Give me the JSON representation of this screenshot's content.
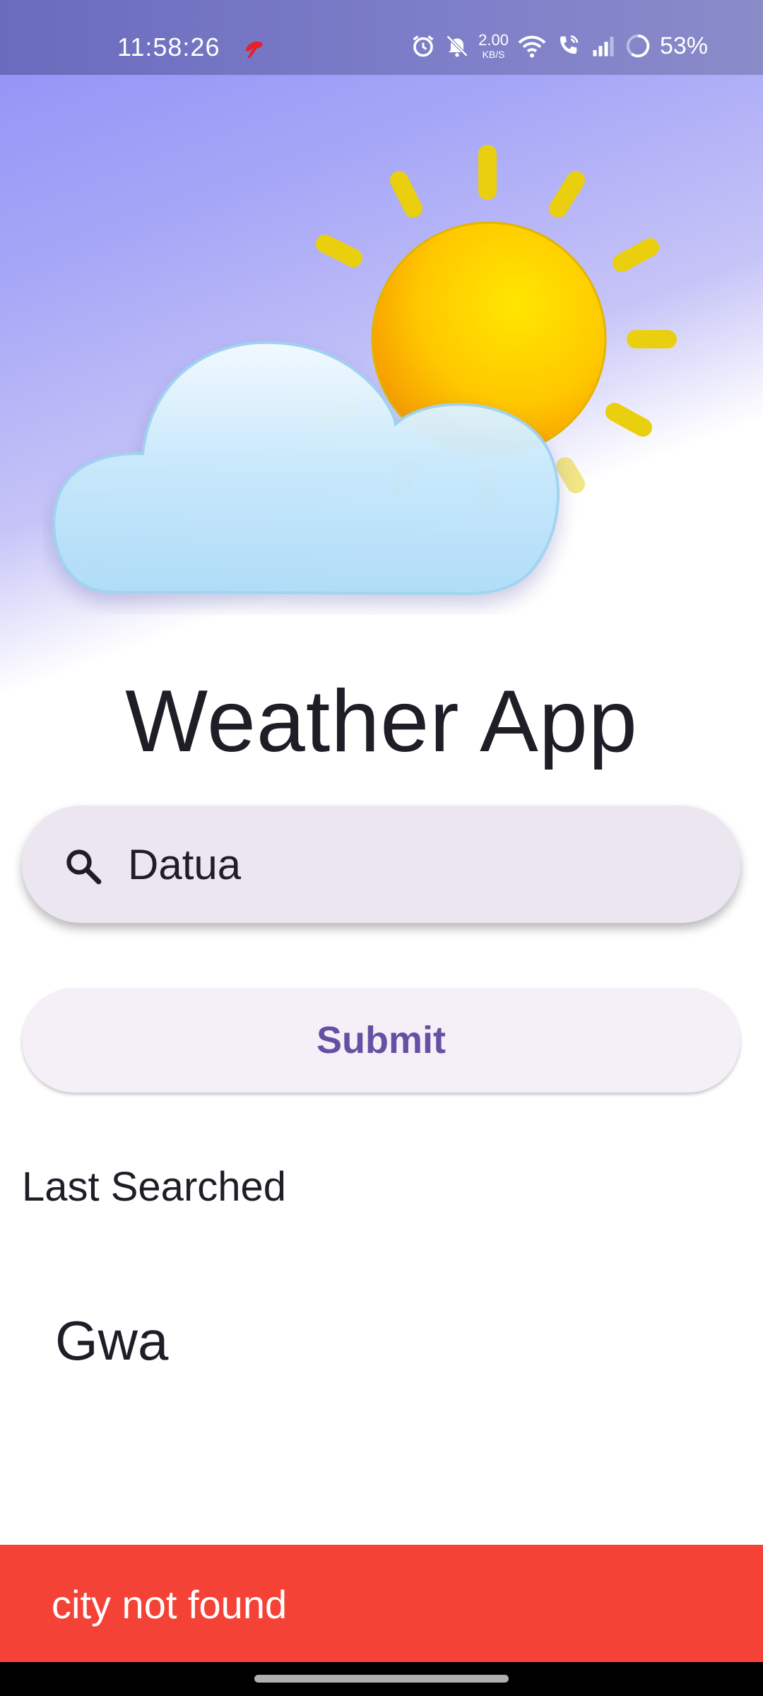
{
  "status_bar": {
    "time": "11:58:26",
    "net_speed_value": "2.00",
    "net_speed_unit": "KB/S",
    "battery": "53%"
  },
  "app": {
    "title": "Weather App"
  },
  "search": {
    "value": "Datua",
    "placeholder": ""
  },
  "submit": {
    "label": "Submit"
  },
  "history": {
    "heading": "Last Searched",
    "items": [
      "Gwa"
    ]
  },
  "snackbar": {
    "message": "city not found"
  },
  "colors": {
    "accent": "#6750a4",
    "error": "#f44336",
    "search_bg": "#ece6f1",
    "button_bg": "#f5f0f8"
  },
  "icons": {
    "weather": "partly-cloudy-sun-icon",
    "search": "search-icon"
  }
}
